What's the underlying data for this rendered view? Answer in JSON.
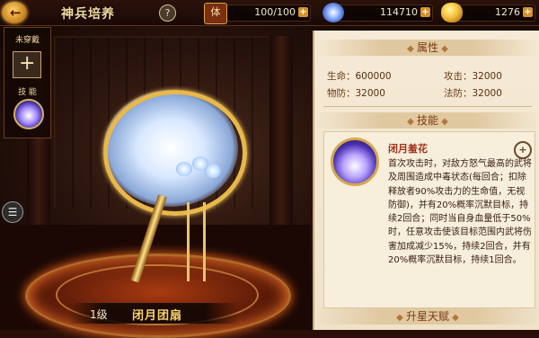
{
  "header": {
    "title": "神兵培养",
    "help": "?",
    "stamina_label": "体",
    "stamina_value": "100/100",
    "silver_value": "114710",
    "gold_value": "1276",
    "plus": "+"
  },
  "left_panel": {
    "unequipped_label": "未穿戴",
    "add_symbol": "+",
    "skill_label": "技 能"
  },
  "weapon": {
    "level": "1级",
    "name": "闭月团扇"
  },
  "attributes": {
    "heading": "属性",
    "hp_label": "生命：",
    "hp_value": "600000",
    "atk_label": "攻击：",
    "atk_value": "32000",
    "pdef_label": "物防：",
    "pdef_value": "32000",
    "mdef_label": "法防：",
    "mdef_value": "32000"
  },
  "skill": {
    "heading": "技能",
    "name": "闭月羞花",
    "description": "首次攻击时，对敌方怒气最高的武将及周围造成中毒状态(每回合；扣除释放者90%攻击力的生命值，无视防御)，并有20%概率沉默目标，持续2回合；同时当自身血量低于50%时，任意攻击使该目标范围内武将伤害加成减少15%，持续2回合，并有20%概率沉默目标，持续1回合。"
  },
  "talent": {
    "heading": "升星天赋"
  },
  "colors": {
    "accent_gold": "#f6d36a",
    "panel_bg": "#f5ead6",
    "skill_name": "#a0321a"
  }
}
